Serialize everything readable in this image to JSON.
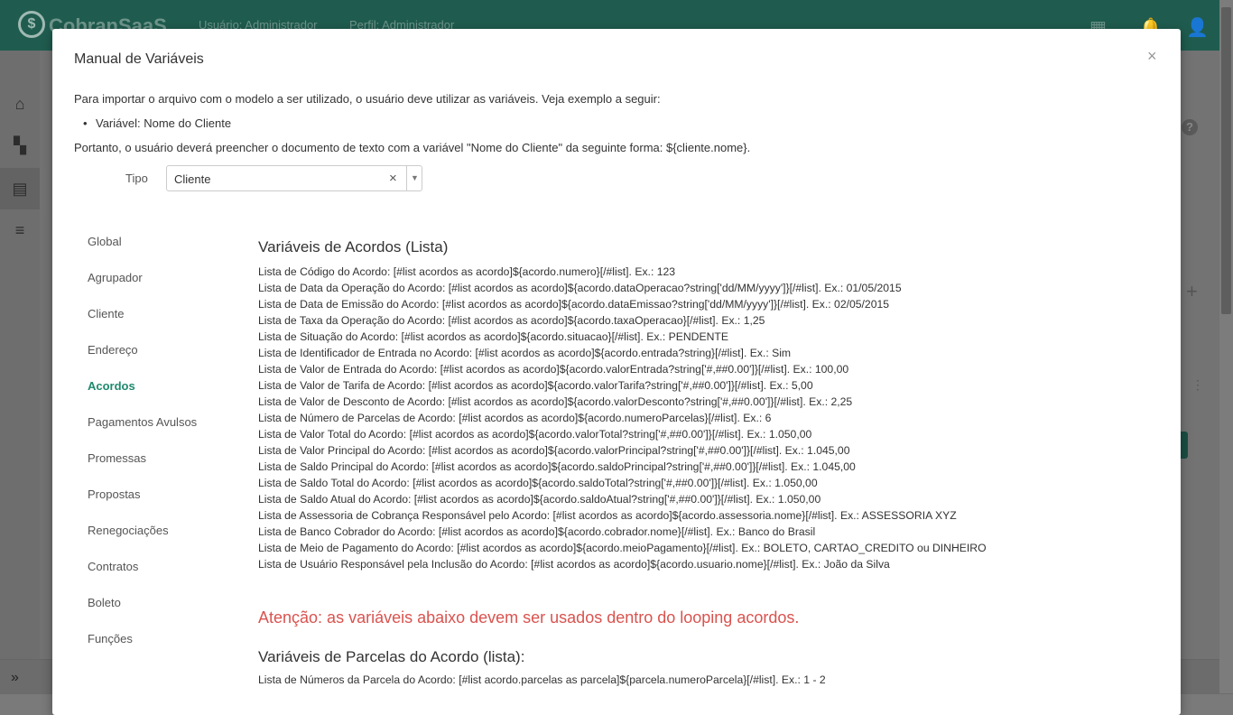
{
  "app": {
    "brand": "CobranSaaS",
    "user_label": "Usuário: Administrador",
    "profile_label": "Perfil: Administrador"
  },
  "modal": {
    "title": "Manual de Variáveis",
    "close": "×",
    "intro": "Para importar o arquivo com o modelo a ser utilizado, o usuário deve utilizar as variáveis. Veja exemplo a seguir:",
    "bullet": "Variável: Nome do Cliente",
    "conclusion": "Portanto, o usuário deverá preencher o documento de texto com a variável \"Nome do Cliente\" da seguinte forma: ${cliente.nome}.",
    "tipo_label": "Tipo",
    "tipo_value": "Cliente",
    "tipo_clear": "×",
    "tipo_arrow": "▼"
  },
  "nav": [
    "Global",
    "Agrupador",
    "Cliente",
    "Endereço",
    "Acordos",
    "Pagamentos Avulsos",
    "Promessas",
    "Propostas",
    "Renegociações",
    "Contratos",
    "Boleto",
    "Funções"
  ],
  "content": {
    "section1_title": "Variáveis de Acordos (Lista)",
    "lines": [
      "Lista de Código do Acordo: [#list acordos as acordo]${acordo.numero}[/#list]. Ex.: 123",
      "Lista de Data da Operação do Acordo: [#list acordos as acordo]${acordo.dataOperacao?string['dd/MM/yyyy']}[/#list]. Ex.: 01/05/2015",
      "Lista de Data de Emissão do Acordo: [#list acordos as acordo]${acordo.dataEmissao?string['dd/MM/yyyy']}[/#list]. Ex.: 02/05/2015",
      "Lista de Taxa da Operação do Acordo: [#list acordos as acordo]${acordo.taxaOperacao}[/#list]. Ex.: 1,25",
      "Lista de Situação do Acordo: [#list acordos as acordo]${acordo.situacao}[/#list]. Ex.: PENDENTE",
      "Lista de Identificador de Entrada no Acordo: [#list acordos as acordo]${acordo.entrada?string}[/#list]. Ex.: Sim",
      "Lista de Valor de Entrada do Acordo: [#list acordos as acordo]${acordo.valorEntrada?string['#,##0.00']}[/#list]. Ex.: 100,00",
      "Lista de Valor de Tarifa de Acordo: [#list acordos as acordo]${acordo.valorTarifa?string['#,##0.00']}[/#list]. Ex.: 5,00",
      "Lista de Valor de Desconto de Acordo: [#list acordos as acordo]${acordo.valorDesconto?string['#,##0.00']}[/#list]. Ex.: 2,25",
      "Lista de Número de Parcelas de Acordo: [#list acordos as acordo]${acordo.numeroParcelas}[/#list]. Ex.: 6",
      "Lista de Valor Total do Acordo: [#list acordos as acordo]${acordo.valorTotal?string['#,##0.00']}[/#list]. Ex.: 1.050,00",
      "Lista de Valor Principal do Acordo: [#list acordos as acordo]${acordo.valorPrincipal?string['#,##0.00']}[/#list]. Ex.: 1.045,00",
      "Lista de Saldo Principal do Acordo: [#list acordos as acordo]${acordo.saldoPrincipal?string['#,##0.00']}[/#list]. Ex.: 1.045,00",
      "Lista de Saldo Total do Acordo: [#list acordos as acordo]${acordo.saldoTotal?string['#,##0.00']}[/#list]. Ex.: 1.050,00",
      "Lista de Saldo Atual do Acordo: [#list acordos as acordo]${acordo.saldoAtual?string['#,##0.00']}[/#list]. Ex.: 1.050,00",
      "Lista de Assessoria de Cobrança Responsável pelo Acordo: [#list acordos as acordo]${acordo.assessoria.nome}[/#list]. Ex.: ASSESSORIA XYZ",
      "Lista de Banco Cobrador do Acordo: [#list acordos as acordo]${acordo.cobrador.nome}[/#list]. Ex.: Banco do Brasil",
      "Lista de Meio de Pagamento do Acordo: [#list acordos as acordo]${acordo.meioPagamento}[/#list]. Ex.: BOLETO, CARTAO_CREDITO ou DINHEIRO",
      "Lista de Usuário Responsável pela Inclusão do Acordo: [#list acordos as acordo]${acordo.usuario.nome}[/#list]. Ex.: João da Silva"
    ],
    "warning": "Atenção: as variáveis abaixo devem ser usados dentro do looping acordos.",
    "section2_title": "Variáveis de Parcelas do Acordo (lista):",
    "section2_lines": [
      "Lista de Números da Parcela do Acordo: [#list acordo.parcelas as parcela]${parcela.numeroParcela}[/#list]. Ex.: 1 - 2"
    ]
  },
  "colors": {
    "topbar": "#1f5c4f",
    "accent": "#1f8a6e",
    "warning": "#d9534f"
  },
  "icons": [
    "home-icon",
    "dashboard-icon",
    "library-icon",
    "sliders-icon",
    "apps-icon",
    "bell-icon",
    "user-icon",
    "help-icon",
    "plus-icon",
    "more-vertical-icon",
    "double-chevron-right-icon"
  ]
}
